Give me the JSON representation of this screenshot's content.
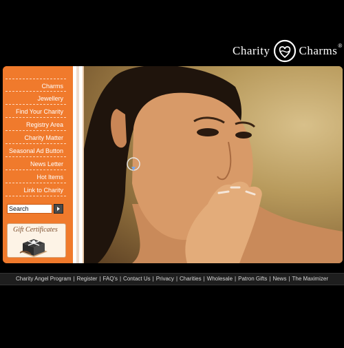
{
  "logo": {
    "word_left": "Charity",
    "word_right": "Charms",
    "registered": "®",
    "icon": "heart-logo-icon"
  },
  "nav": {
    "items": [
      {
        "label": "Charms"
      },
      {
        "label": "Jewellery"
      },
      {
        "label": "Find Your Charity"
      },
      {
        "label": "Registry Area"
      },
      {
        "label": "Charity Matter"
      },
      {
        "label": "Seasonal Ad Button"
      },
      {
        "label": "News Letter"
      },
      {
        "label": "Hot Items"
      },
      {
        "label": "Link to Charity"
      }
    ]
  },
  "search": {
    "value": "Search",
    "button_icon": "arrow-right-icon"
  },
  "gift": {
    "title": "Gift Certificates",
    "icon": "gift-box-icon"
  },
  "footer": {
    "links": [
      "Charity Angel Program",
      "Register",
      "FAQ's",
      "Contact Us",
      "Privacy",
      "Charities",
      "Wholesale",
      "Patron Gifts",
      "News",
      "The Maximizer"
    ],
    "separator": "|"
  },
  "colors": {
    "accent": "#f07a2c",
    "background": "#000000",
    "footer_bar": "#1e1e1e"
  }
}
